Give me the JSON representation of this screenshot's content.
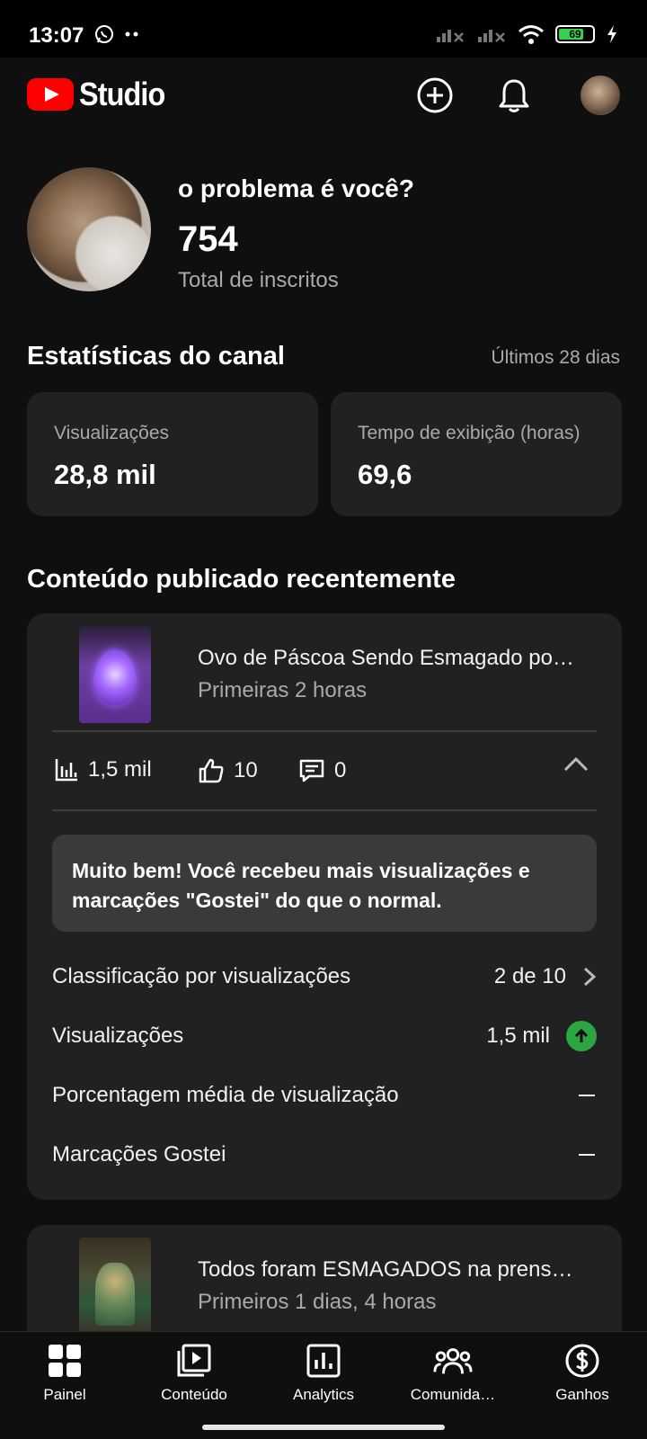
{
  "status_bar": {
    "time": "13:07",
    "battery": "69"
  },
  "header": {
    "app_name": "Studio"
  },
  "channel": {
    "name": "o problema é você?",
    "subscribers": "754",
    "subscribers_label": "Total de inscritos"
  },
  "stats": {
    "title": "Estatísticas do canal",
    "period": "Últimos 28 dias",
    "cards": [
      {
        "label": "Visualizações",
        "value": "28,8 mil"
      },
      {
        "label": "Tempo de exibição (horas)",
        "value": "69,6"
      }
    ]
  },
  "recent": {
    "title": "Conteúdo publicado recentemente",
    "videos": [
      {
        "title": "Ovo de Páscoa Sendo Esmagado po…",
        "subtitle": "Primeiras 2 horas",
        "views": "1,5 mil",
        "likes": "10",
        "comments": "0",
        "insight": "Muito bem! Você recebeu mais visualizações e marcações \"Gostei\" do que o normal.",
        "rows": [
          {
            "label": "Classificação por visualizações",
            "value": "2 de 10"
          },
          {
            "label": "Visualizações",
            "value": "1,5 mil"
          },
          {
            "label": "Porcentagem média de visualização",
            "value": ""
          },
          {
            "label": "Marcações Gostei",
            "value": ""
          }
        ]
      },
      {
        "title": "Todos foram ESMAGADOS na prens…",
        "subtitle": "Primeiros 1 dias, 4 horas"
      }
    ]
  },
  "bottom_nav": [
    {
      "label": "Painel",
      "icon": "dashboard-icon"
    },
    {
      "label": "Conteúdo",
      "icon": "content-icon"
    },
    {
      "label": "Analytics",
      "icon": "analytics-icon"
    },
    {
      "label": "Comunida…",
      "icon": "community-icon"
    },
    {
      "label": "Ganhos",
      "icon": "earnings-icon"
    }
  ],
  "colors": {
    "background": "#0f0f0f",
    "card": "#212121",
    "accent_red": "#ff0000",
    "positive_green": "#2ba640"
  }
}
